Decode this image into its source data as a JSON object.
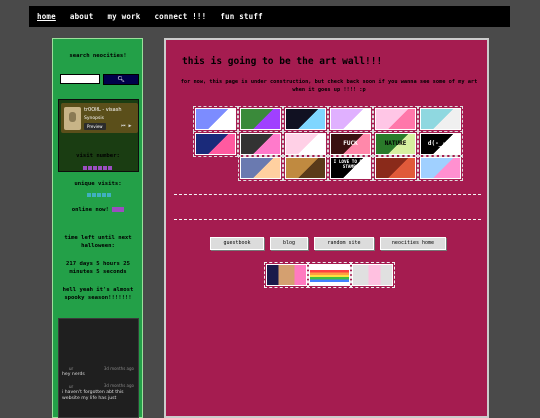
{
  "nav": {
    "items": [
      "home",
      "about",
      "my work",
      "connect !!!",
      "fun stuff"
    ]
  },
  "sidebar": {
    "search_heading": "search neocities!",
    "search_input_value": "",
    "widget": {
      "title": "tr0OlłL - visash",
      "subtitle": "Synopsis",
      "preview_label": "Preview"
    },
    "visit_number_label": "visit number:",
    "unique_visits_label": "unique visits:",
    "online_now_label": "online now!",
    "countdown_heading": "time left until next halloween:",
    "countdown_value": "217 days 5 hours 25 minutes 5 seconds",
    "spooky_text": "hell yeah it's almost spooky season!!!!!!!",
    "chat": [
      {
        "user": "ur",
        "time": "3d months ago",
        "message": "hey nerds"
      },
      {
        "user": "ur",
        "time": "3d months ago",
        "message": "i haven't forgotten abt this website my life has just"
      }
    ]
  },
  "main": {
    "title": "this is going to be the art wall!!!",
    "subtitle": "for now, this page is under construction, but check back soon if you wanna see some of my art when it goes up !!!! :p",
    "stamps": [
      {
        "label": "",
        "colors": [
          "#7c8cff",
          "#ffffff"
        ]
      },
      {
        "label": "",
        "colors": [
          "#3a8a3a",
          "#a040ff"
        ]
      },
      {
        "label": "",
        "colors": [
          "#111122",
          "#7fd6ff"
        ]
      },
      {
        "label": "",
        "colors": [
          "#e0b0ff",
          "#ffffff"
        ]
      },
      {
        "label": "",
        "colors": [
          "#ffc6e6",
          "#ff77aa"
        ]
      },
      {
        "label": "",
        "colors": [
          "#8fd8e0",
          "#f0f0f0"
        ]
      },
      {
        "label": "",
        "colors": [
          "#1a2a7a",
          "#ff5aa0"
        ]
      },
      {
        "label": "",
        "colors": [
          "#333333",
          "#ff7acb"
        ]
      },
      {
        "label": "",
        "colors": [
          "#ffd0e6",
          "#ffffff"
        ]
      },
      {
        "label": "FUCK",
        "colors": [
          "#3a1010",
          "#ff88aa"
        ]
      },
      {
        "label": "NATURE",
        "colors": [
          "#2a7a2a",
          "#d7f0a0"
        ]
      },
      {
        "label": "d(-_-)b",
        "colors": [
          "#000000",
          "#ffffff"
        ]
      },
      {
        "label": "",
        "colors": [
          "#6a7ab0",
          "#ffd0a0"
        ]
      },
      {
        "label": "",
        "colors": [
          "#c08a40",
          "#5a3a1a"
        ]
      },
      {
        "label": "I LOVE TO EAT STAMPS",
        "colors": [
          "#000000",
          "#ffffff"
        ]
      },
      {
        "label": "",
        "colors": [
          "#8a2a1a",
          "#e05a3a"
        ]
      },
      {
        "label": "",
        "colors": [
          "#a0d0ff",
          "#ff90d0"
        ]
      }
    ],
    "buttons": [
      "guestbook",
      "blog",
      "random site",
      "neocities home"
    ]
  }
}
